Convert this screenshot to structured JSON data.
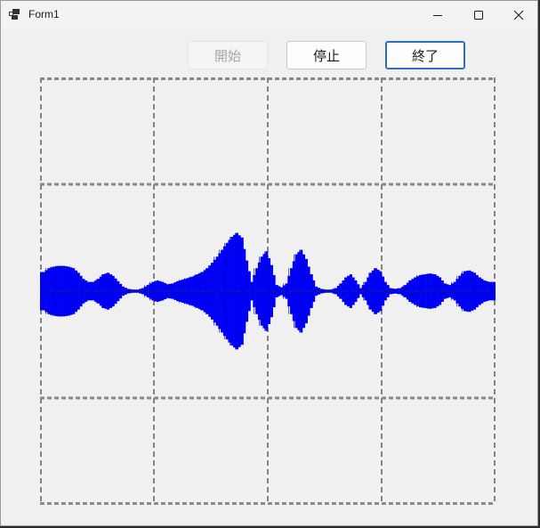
{
  "window": {
    "title": "Form1"
  },
  "buttons": {
    "start_label": "開始",
    "stop_label": "停止",
    "exit_label": "終了"
  },
  "oscilloscope": {
    "grid_columns": 4,
    "grid_rows": 4,
    "grid_color": "#3c3c3c",
    "waveform_color": "#0000ff",
    "waveform_outline_color": "#0000c8",
    "envelope": [
      0.25,
      0.3,
      0.32,
      0.33,
      0.33,
      0.32,
      0.3,
      0.24,
      0.16,
      0.12,
      0.12,
      0.16,
      0.22,
      0.24,
      0.2,
      0.13,
      0.06,
      0.03,
      0.02,
      0.02,
      0.04,
      0.08,
      0.12,
      0.14,
      0.12,
      0.09,
      0.1,
      0.13,
      0.15,
      0.17,
      0.19,
      0.22,
      0.25,
      0.3,
      0.37,
      0.45,
      0.54,
      0.63,
      0.71,
      0.76,
      0.7,
      0.4,
      0.12,
      0.3,
      0.45,
      0.52,
      0.34,
      0.08,
      0.05,
      0.1,
      0.3,
      0.48,
      0.54,
      0.42,
      0.22,
      0.06,
      0.03,
      0.02,
      0.02,
      0.04,
      0.1,
      0.18,
      0.22,
      0.14,
      0.04,
      0.12,
      0.24,
      0.3,
      0.26,
      0.12,
      0.04,
      0.03,
      0.04,
      0.08,
      0.14,
      0.18,
      0.21,
      0.22,
      0.23,
      0.22,
      0.18,
      0.1,
      0.08,
      0.12,
      0.2,
      0.26,
      0.27,
      0.24,
      0.18,
      0.14,
      0.12,
      0.12
    ]
  }
}
